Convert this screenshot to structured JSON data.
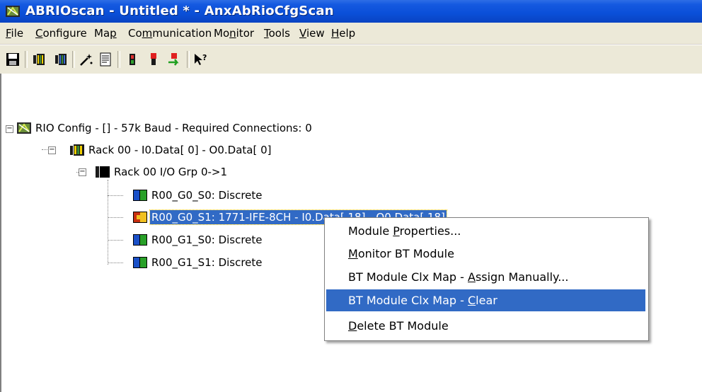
{
  "window": {
    "title": "ABRIOscan - Untitled * - AnxAbRioCfgScan"
  },
  "menu": [
    {
      "label": "File",
      "accel": "F",
      "rest": "ile"
    },
    {
      "label": "Configure",
      "accel": "C",
      "rest": "onfigure"
    },
    {
      "label": "Map",
      "pre": "Ma",
      "accel": "p",
      "rest": ""
    },
    {
      "label": "Communication",
      "pre": "Co",
      "accel": "m",
      "rest": "munication"
    },
    {
      "label": "Monitor",
      "pre": "Mo",
      "accel": "n",
      "rest": "itor"
    },
    {
      "label": "Tools",
      "accel": "T",
      "rest": "ools"
    },
    {
      "label": "View",
      "accel": "V",
      "rest": "iew"
    },
    {
      "label": "Help",
      "accel": "H",
      "rest": "elp"
    }
  ],
  "toolbar": {
    "buttons": [
      "save-icon",
      "rack-icon",
      "rack-blue-icon",
      "wand-icon",
      "list-icon",
      "slot-icon",
      "red-module-icon",
      "green-arrow-icon",
      "help-pointer-icon"
    ]
  },
  "tree": {
    "root": "RIO Config - [] -  57k Baud - Required Connections: 0",
    "rack": "Rack 00 - I0.Data[  0] - O0.Data[  0]",
    "group": "Rack 00 I/O Grp 0->1",
    "modules": [
      {
        "label": "R00_G0_S0: Discrete",
        "icon": "discrete-module-icon",
        "selected": false
      },
      {
        "label": "R00_G0_S1: 1771-IFE-8CH - I0.Data[ 18] - O0.Data[ 18]",
        "icon": "bt-module-icon",
        "selected": true
      },
      {
        "label": "R00_G1_S0: Discrete",
        "icon": "discrete-module-icon",
        "selected": false
      },
      {
        "label": "R00_G1_S1: Discrete",
        "icon": "discrete-module-icon",
        "selected": false
      }
    ]
  },
  "context_menu": {
    "items": [
      {
        "pre": "Module ",
        "accel": "P",
        "rest": "roperties...",
        "hover": false
      },
      {
        "pre": "",
        "accel": "M",
        "rest": "onitor BT Module",
        "hover": false
      },
      {
        "pre": "BT Module Clx Map - ",
        "accel": "A",
        "rest": "ssign Manually...",
        "hover": false
      },
      {
        "pre": "BT Module Clx Map - ",
        "accel": "C",
        "rest": "lear",
        "hover": true
      },
      {
        "pre": "",
        "accel": "D",
        "rest": "elete BT Module",
        "hover": false
      }
    ]
  },
  "colors": {
    "titlebar": "#0a4fd8",
    "selection": "#316ac5",
    "menubar": "#ece9d8"
  }
}
